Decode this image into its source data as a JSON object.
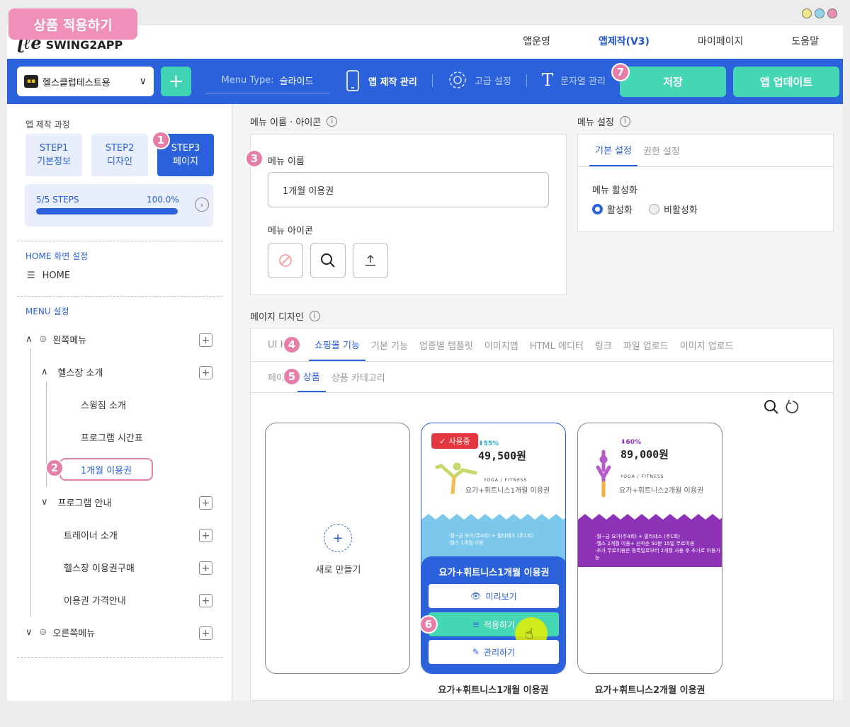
{
  "title_tag": "상품 적용하기",
  "window_dots": [
    "#f0e68c",
    "#8fd3e8",
    "#e88fb4"
  ],
  "header": {
    "logo": "SWING2APP",
    "nav": [
      "앱운영",
      "앱제작(V3)",
      "마이페이지",
      "도움말"
    ],
    "active_nav": "앱제작(V3)"
  },
  "toolbar": {
    "app_name": "헬스클럽테스트용",
    "add_label": "+",
    "menu_type_label": "Menu Type:",
    "menu_type_value": "슬라이드",
    "app_manage": "앱 제작 관리",
    "advanced": "고급 설정",
    "strings": "문자열 관리",
    "save": "저장",
    "update": "앱 업데이트"
  },
  "sidebar": {
    "process_title": "앱 제작 과정",
    "steps": [
      {
        "line1": "STEP1",
        "line2": "기본정보"
      },
      {
        "line1": "STEP2",
        "line2": "디자인"
      },
      {
        "line1": "STEP3",
        "line2": "페이지"
      }
    ],
    "progress_label": "5/5 STEPS",
    "progress_pct": "100.0%",
    "progress_value": 1.0,
    "home_section": "HOME 화면 설정",
    "home_item": "HOME",
    "menu_section": "MENU 설정",
    "left_menu": "왼쪽메뉴",
    "gym_intro": "헬스장 소개",
    "sub_items": [
      "스윙짐 소개",
      "프로그램 시간표",
      "1개월 이용권"
    ],
    "program_guide": "프로그램 안내",
    "trainer": "트레이너 소개",
    "ticket_buy": "헬스장 이용권구매",
    "price_guide": "이용권 가격안내",
    "right_menu": "오른쪽메뉴"
  },
  "menu_name_section": {
    "title": "메뉴 이름 · 아이콘",
    "name_label": "메뉴 이름",
    "name_value": "1개월 이용권",
    "icon_label": "메뉴 아이콘"
  },
  "menu_settings": {
    "title": "메뉴 설정",
    "tabs": [
      "기본 설정",
      "권한 설정"
    ],
    "activation_label": "메뉴 활성화",
    "options": [
      "활성화",
      "비활성화"
    ]
  },
  "page_design": {
    "title": "페이지 디자인",
    "tabs": [
      "UI K",
      "쇼핑몰 기능",
      "기본 기능",
      "업종별 템플릿",
      "이미지맵",
      "HTML 에디터",
      "링크",
      "파일 업로드",
      "이미지 업로드"
    ],
    "subtabs": [
      "페이",
      "상품",
      "상품 카테고리"
    ]
  },
  "cards": {
    "new_label": "새로 만들기",
    "in_use": "사용중",
    "card1": {
      "discount": "55%",
      "price": "49,500원",
      "category": "YOGA / FITNESS",
      "name": "요가+휘트니스1개월 이용권",
      "desc1": "·월~금 요가(주4회) + 필라테스 (주1회)",
      "desc2": "·헬스 1개월 이용",
      "overlay_title": "요가+휘트니스1개월 이용권",
      "preview": "미리보기",
      "apply": "적용하기",
      "manage": "관리하기",
      "caption": "요가+휘트니스1개월 이용권"
    },
    "card2": {
      "discount": "60%",
      "price": "89,000원",
      "category": "YOGA / FITNESS",
      "name": "요가+휘트니스2개월 이용권",
      "desc1": "·월~금 요가(주4회) + 필라테스 (주1회)",
      "desc2": "·헬스 2개월 이용+ 선착순 50분 15일 무료이용",
      "desc3": "·추가 무료이용은 등록일로부터 2개월 사용 후 추가로 이용가능",
      "caption": "요가+휘트니스2개월 이용권"
    }
  },
  "markers": [
    "1",
    "2",
    "3",
    "4",
    "5",
    "6",
    "7"
  ],
  "colors": {
    "primary": "#2b62dc",
    "accent": "#45d6b4",
    "marker": "#e77ea7",
    "purple": "#8e32b8",
    "sky": "#7cc8ec"
  }
}
